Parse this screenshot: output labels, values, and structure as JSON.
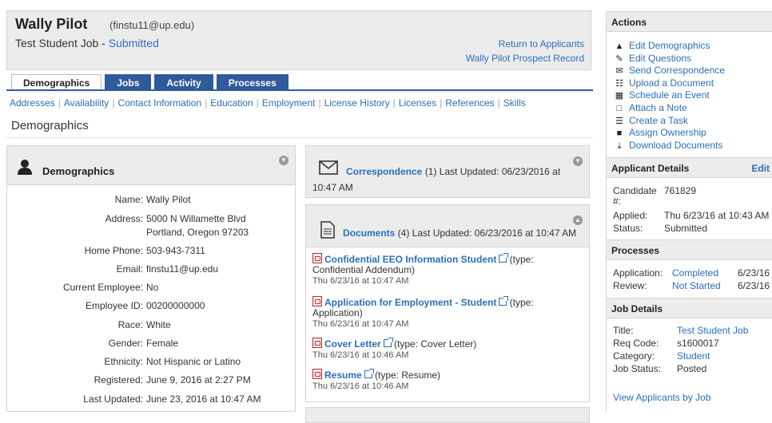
{
  "header": {
    "name": "Wally Pilot",
    "email": "(finstu11@up.edu)",
    "job_title": "Test Student Job - ",
    "job_status": "Submitted",
    "return_link": "Return to Applicants",
    "prospect_link": "Wally Pilot Prospect Record"
  },
  "tabs": [
    "Demographics",
    "Jobs",
    "Activity",
    "Processes"
  ],
  "subnav": [
    "Addresses",
    "Availability",
    "Contact Information",
    "Education",
    "Employment",
    "License History",
    "Licenses",
    "References",
    "Skills"
  ],
  "section_title": "Demographics",
  "demographics": {
    "title": "Demographics",
    "fields": [
      {
        "label": "Name:",
        "value": "Wally Pilot"
      },
      {
        "label": "Address:",
        "value": "5000 N Willamette Blvd",
        "value2": "Portland, Oregon 97203"
      },
      {
        "label": "Home Phone:",
        "value": "503-943-7311"
      },
      {
        "label": "Email:",
        "value": "finstu11@up.edu"
      },
      {
        "label": "Current Employee:",
        "value": "No"
      },
      {
        "label": "Employee ID:",
        "value": "00200000000"
      },
      {
        "label": "Race:",
        "value": "White"
      },
      {
        "label": "Gender:",
        "value": "Female"
      },
      {
        "label": "Ethnicity:",
        "value": "Not Hispanic or Latino"
      },
      {
        "label": "Registered:",
        "value": "June 9, 2016 at 2:27 PM"
      },
      {
        "label": "Last Updated:",
        "value": "June 23, 2016 at 10:47 AM"
      }
    ]
  },
  "correspondence": {
    "link": "Correspondence",
    "count_text": " (1) Last Updated: 06/23/2016 at",
    "time": "10:47 AM"
  },
  "documents": {
    "link": "Documents",
    "count_text": " (4) Last Updated: 06/23/2016 at 10:47 AM",
    "items": [
      {
        "name": "Confidential EEO Information Student",
        "type": " (type:",
        "type2": "Confidential Addendum)",
        "date": "Thu 6/23/16 at 10:47 AM"
      },
      {
        "name": "Application for Employment - Student",
        "type": " (type:",
        "type2": "Application)",
        "date": "Thu 6/23/16 at 10:47 AM"
      },
      {
        "name": "Cover Letter",
        "type": " (type: Cover Letter)",
        "type2": "",
        "date": "Thu 6/23/16 at 10:46 AM"
      },
      {
        "name": "Resume",
        "type": " (type: Resume)",
        "type2": "",
        "date": "Thu 6/23/16 at 10:46 AM"
      }
    ]
  },
  "sidebar": {
    "actions_title": "Actions",
    "actions": [
      {
        "icon": "user-icon",
        "glyph": "▲",
        "label": "Edit Demographics"
      },
      {
        "icon": "pencil-icon",
        "glyph": "✎",
        "label": "Edit Questions"
      },
      {
        "icon": "envelope-icon",
        "glyph": "✉",
        "label": "Send Correspondence"
      },
      {
        "icon": "document-icon",
        "glyph": "☷",
        "label": "Upload a Document"
      },
      {
        "icon": "calendar-icon",
        "glyph": "▦",
        "label": "Schedule an Event"
      },
      {
        "icon": "note-icon",
        "glyph": "□",
        "label": "Attach a Note"
      },
      {
        "icon": "task-icon",
        "glyph": "☰",
        "label": "Create a Task"
      },
      {
        "icon": "lock-icon",
        "glyph": "■",
        "label": "Assign Ownership"
      },
      {
        "icon": "download-icon",
        "glyph": "⤓",
        "label": "Download Documents"
      }
    ],
    "applicant_title": "Applicant Details",
    "applicant_edit": "Edit",
    "candidate_label": "Candidate",
    "candidate_label2": "#:",
    "candidate_value": "761829",
    "applied_label": "Applied:",
    "applied_value": "Thu 6/23/16 at 10:43 AM",
    "status_label": "Status:",
    "status_value": "Submitted",
    "processes_title": "Processes",
    "processes": [
      {
        "label": "Application:",
        "value": "Completed",
        "date": "6/23/16"
      },
      {
        "label": "Review:",
        "value": "Not Started",
        "date": "6/23/16"
      }
    ],
    "job_title": "Job Details",
    "job_fields": [
      {
        "label": "Title:",
        "value": "Test Student Job",
        "link": true
      },
      {
        "label": "Req Code:",
        "value": "s1600017",
        "link": false
      },
      {
        "label": "Category:",
        "value": "Student",
        "link": true
      },
      {
        "label": "Job Status:",
        "value": "Posted",
        "link": false
      }
    ],
    "view_link": "View Applicants by Job"
  }
}
